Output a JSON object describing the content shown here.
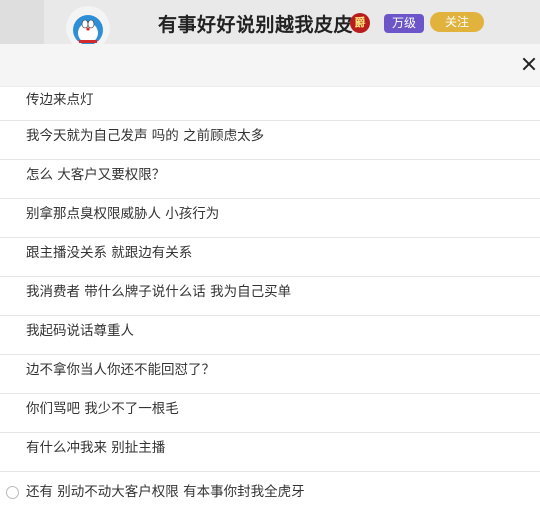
{
  "header": {
    "room_title": "有事好好说别越我皮皮",
    "rank_icon_glyph": "爵",
    "level_badge": "万级",
    "follow_label": "关注",
    "colors": {
      "level_badge": "#6c55c9",
      "follow_button": "#e2b33c"
    }
  },
  "panel": {
    "messages": [
      "传边来点灯",
      "我今天就为自己发声 吗的 之前顾虑太多",
      "怎么 大客户又要权限？",
      "别拿那点臭权限威胁人 小孩行为",
      "跟主播没关系 就跟边有关系",
      "我消费者 带什么牌子说什么话 我为自己买单",
      "我起码说话尊重人",
      "边不拿你当人你还不能回怼了？",
      "你们骂吧 我少不了一根毛",
      "有什么冲我来 别扯主播",
      "还有 别动不动大客户权限 有本事你封我全虎牙"
    ]
  },
  "icons": {
    "close": "close-icon",
    "avatar": "doraemon-avatar"
  }
}
